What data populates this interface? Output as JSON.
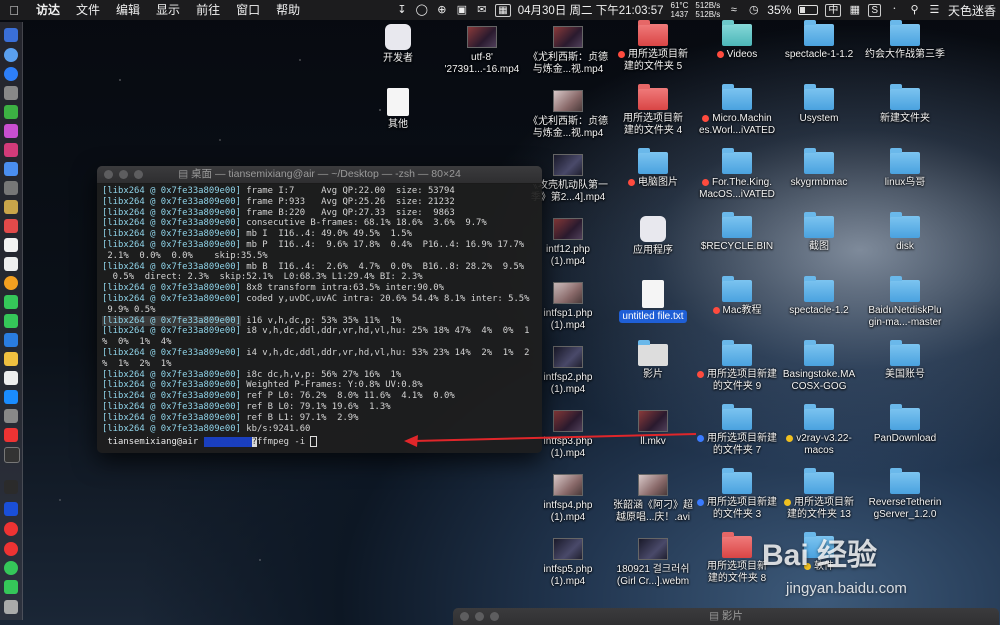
{
  "menubar": {
    "app_name": "访达",
    "menus": [
      "文件",
      "编辑",
      "显示",
      "前往",
      "窗口",
      "帮助"
    ],
    "temps": [
      "61°C",
      "1437"
    ],
    "net_rates": [
      "512B/s",
      "512B/s"
    ],
    "date_time": "04月30日 周二 下午21:03:57",
    "weather": "天气",
    "battery": "35%",
    "input_method": "中",
    "user": "天色迷香"
  },
  "terminal": {
    "title": "桌面 — tiansemixiang@air — ~/Desktop — -zsh — 80×24",
    "lines": [
      {
        "prefix": "[libx264 @ 0x7fe33a809e00]",
        "text": " frame I:7     Avg QP:22.00  size: 53794"
      },
      {
        "prefix": "[libx264 @ 0x7fe33a809e00]",
        "text": " frame P:933   Avg QP:25.26  size: 21232"
      },
      {
        "prefix": "[libx264 @ 0x7fe33a809e00]",
        "text": " frame B:220   Avg QP:27.33  size:  9863"
      },
      {
        "prefix": "[libx264 @ 0x7fe33a809e00]",
        "text": " consecutive B-frames: 68.1% 18.6%  3.6%  9.7%"
      },
      {
        "prefix": "[libx264 @ 0x7fe33a809e00]",
        "text": " mb I  I16..4: 49.0% 49.5%  1.5%"
      },
      {
        "prefix": "[libx264 @ 0x7fe33a809e00]",
        "text": " mb P  I16..4:  9.6% 17.8%  0.4%  P16..4: 16.9% 17.7%"
      },
      {
        "prefix": "",
        "text": " 2.1%  0.0%  0.0%    skip:35.5%"
      },
      {
        "prefix": "[libx264 @ 0x7fe33a809e00]",
        "text": " mb B  I16..4:  2.6%  4.7%  0.0%  B16..8: 28.2%  9.5%"
      },
      {
        "prefix": "",
        "text": "  0.5%  direct: 2.3%  skip:52.1%  L0:68.3% L1:29.4% BI: 2.3%"
      },
      {
        "prefix": "[libx264 @ 0x7fe33a809e00]",
        "text": " 8x8 transform intra:63.5% inter:90.0%"
      },
      {
        "prefix": "[libx264 @ 0x7fe33a809e00]",
        "text": " coded y,uvDC,uvAC intra: 20.6% 54.4% 8.1% inter: 5.5%"
      },
      {
        "prefix": "",
        "text": " 9.9% 0.5%"
      },
      {
        "prefix": "[libx264 @ 0x7fe33a809e00]",
        "text": " i16 v,h,dc,p: 53% 35% 11%  1%",
        "boxed": true
      },
      {
        "prefix": "[libx264 @ 0x7fe33a809e00]",
        "text": " i8 v,h,dc,ddl,ddr,vr,hd,vl,hu: 25% 18% 47%  4%  0%  1"
      },
      {
        "prefix": "",
        "text": "%  0%  1%  4%"
      },
      {
        "prefix": "[libx264 @ 0x7fe33a809e00]",
        "text": " i4 v,h,dc,ddl,ddr,vr,hd,vl,hu: 53% 23% 14%  2%  1%  2"
      },
      {
        "prefix": "",
        "text": "%  1%  2%  1%"
      },
      {
        "prefix": "[libx264 @ 0x7fe33a809e00]",
        "text": " i8c dc,h,v,p: 56% 27% 16%  1%"
      },
      {
        "prefix": "[libx264 @ 0x7fe33a809e00]",
        "text": " Weighted P-Frames: Y:0.8% UV:0.8%"
      },
      {
        "prefix": "[libx264 @ 0x7fe33a809e00]",
        "text": " ref P L0: 76.2%  8.0% 11.6%  4.1%  0.0%"
      },
      {
        "prefix": "[libx264 @ 0x7fe33a809e00]",
        "text": " ref B L0: 79.1% 19.6%  1.3%"
      },
      {
        "prefix": "[libx264 @ 0x7fe33a809e00]",
        "text": " ref B L1: 97.1%  2.9%"
      },
      {
        "prefix": "[libx264 @ 0x7fe33a809e00]",
        "text": " kb/s:9241.60"
      }
    ],
    "prompt_user": "tiansemixiang@air",
    "prompt_path": "~/Desktop",
    "prompt_git": "?",
    "command": "ffmpeg -i "
  },
  "desktop_icons": {
    "c1": [
      {
        "label": "开发者",
        "kind": "app"
      },
      {
        "label": "其他",
        "kind": "doc"
      }
    ],
    "c2": [
      {
        "label": "utf-8'\n'27391...-16.mp4",
        "kind": "video"
      }
    ],
    "c3": [
      {
        "label": "《尤利西斯：贞德\n与炼金...视.mp4",
        "kind": "video"
      },
      {
        "label": "《尤利西斯：贞德\n与炼金...视.mp4",
        "kind": "video"
      },
      {
        "label": "《攻壳机动队第一\n季》第2...4].mp4",
        "kind": "video"
      },
      {
        "label": "intf12.php\n(1).mp4",
        "kind": "video"
      },
      {
        "label": "intfsp1.php\n(1).mp4",
        "kind": "video"
      },
      {
        "label": "intfsp2.php\n(1).mp4",
        "kind": "video"
      },
      {
        "label": "intfsp3.php\n(1).mp4",
        "kind": "video"
      },
      {
        "label": "intfsp4.php\n(1).mp4",
        "kind": "video"
      },
      {
        "label": "intfsp5.php\n(1).mp4",
        "kind": "video"
      }
    ],
    "c4": [
      {
        "label": "用所选项目新\n建的文件夹 5",
        "kind": "folder-red",
        "dot": "red"
      },
      {
        "label": "用所选项目新\n建的文件夹 4",
        "kind": "folder-red"
      },
      {
        "label": "电脑图片",
        "kind": "folder",
        "dot": "red"
      },
      {
        "label": "应用程序",
        "kind": "app"
      },
      {
        "label": "untitled file.txt",
        "kind": "doc",
        "selected": true
      },
      {
        "label": "影片",
        "kind": "folder-dark"
      },
      {
        "label": "ll.mkv",
        "kind": "video"
      },
      {
        "label": "张韶涵《阿刁》超\n越原唱...庆！.avi",
        "kind": "video"
      },
      {
        "label": "180921 걸크러쉬\n(Girl Cr...].webm",
        "kind": "video"
      }
    ],
    "c5": [
      {
        "label": "Videos",
        "kind": "folder-teal",
        "dot": "red"
      },
      {
        "label": "Micro.Machin\nes.Worl...iVATED",
        "kind": "folder",
        "dot": "red"
      },
      {
        "label": "For.The.King.\nMacOS...iVATED",
        "kind": "folder",
        "dot": "red"
      },
      {
        "label": "$RECYCLE.BIN",
        "kind": "folder"
      },
      {
        "label": "Mac教程",
        "kind": "folder",
        "dot": "red"
      },
      {
        "label": "用所选项目新建\n的文件夹 9",
        "kind": "folder",
        "dot": "red"
      },
      {
        "label": "用所选项目新建\n的文件夹 7",
        "kind": "folder",
        "dot": "blue"
      },
      {
        "label": "用所选项目新建\n的文件夹 3",
        "kind": "folder",
        "dot": "blue"
      },
      {
        "label": "用所选项目新\n建的文件夹 8",
        "kind": "folder-red"
      }
    ],
    "c6": [
      {
        "label": "spectacle-1-1.2",
        "kind": "folder"
      },
      {
        "label": "Usystem",
        "kind": "folder"
      },
      {
        "label": "skygrmbmac",
        "kind": "folder"
      },
      {
        "label": "截图",
        "kind": "folder"
      },
      {
        "label": "spectacle-1.2",
        "kind": "folder"
      },
      {
        "label": "Basingstoke.MA\nCOSX-GOG",
        "kind": "folder"
      },
      {
        "label": "v2ray-v3.22-\nmacos",
        "kind": "folder",
        "dot": "yellow"
      },
      {
        "label": "用所选项目新\n建的文件夹 13",
        "kind": "folder",
        "dot": "yellow"
      },
      {
        "label": "软件",
        "kind": "folder",
        "dot": "yellow"
      }
    ],
    "c7": [
      {
        "label": "约会大作战第三季",
        "kind": "folder"
      },
      {
        "label": "新建文件夹",
        "kind": "folder"
      },
      {
        "label": "linux鸟哥",
        "kind": "folder"
      },
      {
        "label": "disk",
        "kind": "folder"
      },
      {
        "label": "BaiduNetdiskPlu\ngin-ma...-master",
        "kind": "folder"
      },
      {
        "label": "美国账号",
        "kind": "folder"
      },
      {
        "label": "PanDownload",
        "kind": "folder"
      },
      {
        "label": "ReverseTetherin\ngServer_1.2.0",
        "kind": "folder"
      }
    ]
  },
  "finder_bottom_title": "影片",
  "watermark": {
    "main": "Bai 经验",
    "sub": "jingyan.baidu.com"
  }
}
